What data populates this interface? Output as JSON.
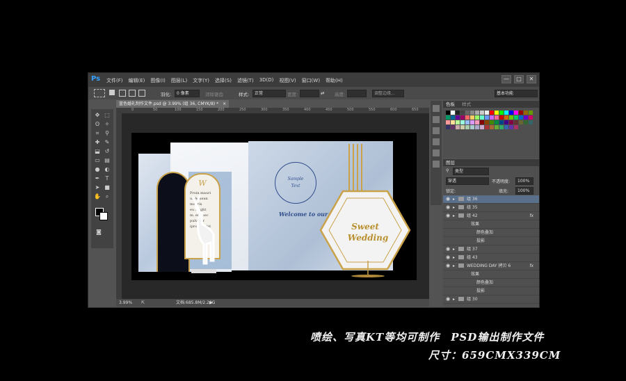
{
  "app": {
    "logo": "Ps",
    "menu": [
      "文件(F)",
      "编辑(E)",
      "图像(I)",
      "图层(L)",
      "文字(Y)",
      "选择(S)",
      "滤镜(T)",
      "3D(D)",
      "视图(V)",
      "窗口(W)",
      "帮助(H)"
    ],
    "window_buttons": [
      "—",
      "□",
      "✕"
    ]
  },
  "options_bar": {
    "feather_label": "羽化:",
    "feather_value": "0 像素",
    "antialias": "消除锯齿",
    "style_label": "样式:",
    "style_value": "正常",
    "width_label": "宽度:",
    "height_label": "高度:",
    "refine_edge": "调整边缘...",
    "workspace": "基本功能"
  },
  "document": {
    "tab_title": "蓝色婚礼制作文件.psd @ 3.99% (组 36, CMYK/8) *",
    "close": "×",
    "zoom": "3.99%",
    "doc_size": "文档:685.8M/2.20G",
    "ruler_ticks": [
      "0",
      "50",
      "100",
      "150",
      "200",
      "250",
      "300",
      "350",
      "400",
      "450",
      "500",
      "550",
      "600",
      "650"
    ]
  },
  "artwork": {
    "monogram_line1": "Welcome to our wedding",
    "monogram_center1": "Sample",
    "monogram_center2": "Text",
    "welcome": "Welcome to our wedding",
    "hex_line1": "Sweet",
    "hex_line2": "Wedding",
    "arch_title": "W",
    "arch_text": [
      "Proin mauri",
      "ut Aenean",
      "mauris",
      "eu bright",
      "m. elit nec",
      "pulvinar",
      "ipro. Sat fet"
    ]
  },
  "swatches_panel": {
    "tabs": [
      "色板",
      "样式"
    ]
  },
  "layers_panel": {
    "tab": "图层",
    "kind": "类型",
    "blend": "穿透",
    "opacity_label": "不透明度:",
    "opacity_value": "100%",
    "lock_label": "锁定:",
    "fill_label": "填充:",
    "fill_value": "100%",
    "layers": [
      {
        "name": "组 36",
        "type": "group",
        "selected": true
      },
      {
        "name": "组 35",
        "type": "group"
      },
      {
        "name": "组 42",
        "type": "group",
        "fx": "fx"
      },
      {
        "name": "效果",
        "type": "effect-title"
      },
      {
        "name": "颜色叠加",
        "type": "effect"
      },
      {
        "name": "投影",
        "type": "effect"
      },
      {
        "name": "组 37",
        "type": "group"
      },
      {
        "name": "组 43",
        "type": "group"
      },
      {
        "name": "WEDDING DAY 拷贝 6",
        "type": "group",
        "fx": "fx"
      },
      {
        "name": "效果",
        "type": "effect-title"
      },
      {
        "name": "颜色叠加",
        "type": "effect"
      },
      {
        "name": "投影",
        "type": "effect"
      },
      {
        "name": "组 30",
        "type": "group"
      }
    ]
  },
  "caption": {
    "line1": "喷绘、写真KT等均可制作　PSD输出制作文件",
    "line2": "尺寸：659CMX339CM"
  },
  "colors": {
    "accent": "#33a0ff",
    "gold": "#c9a24a",
    "navy": "#2f4d8a",
    "selected_layer": "#5a6f8a"
  }
}
